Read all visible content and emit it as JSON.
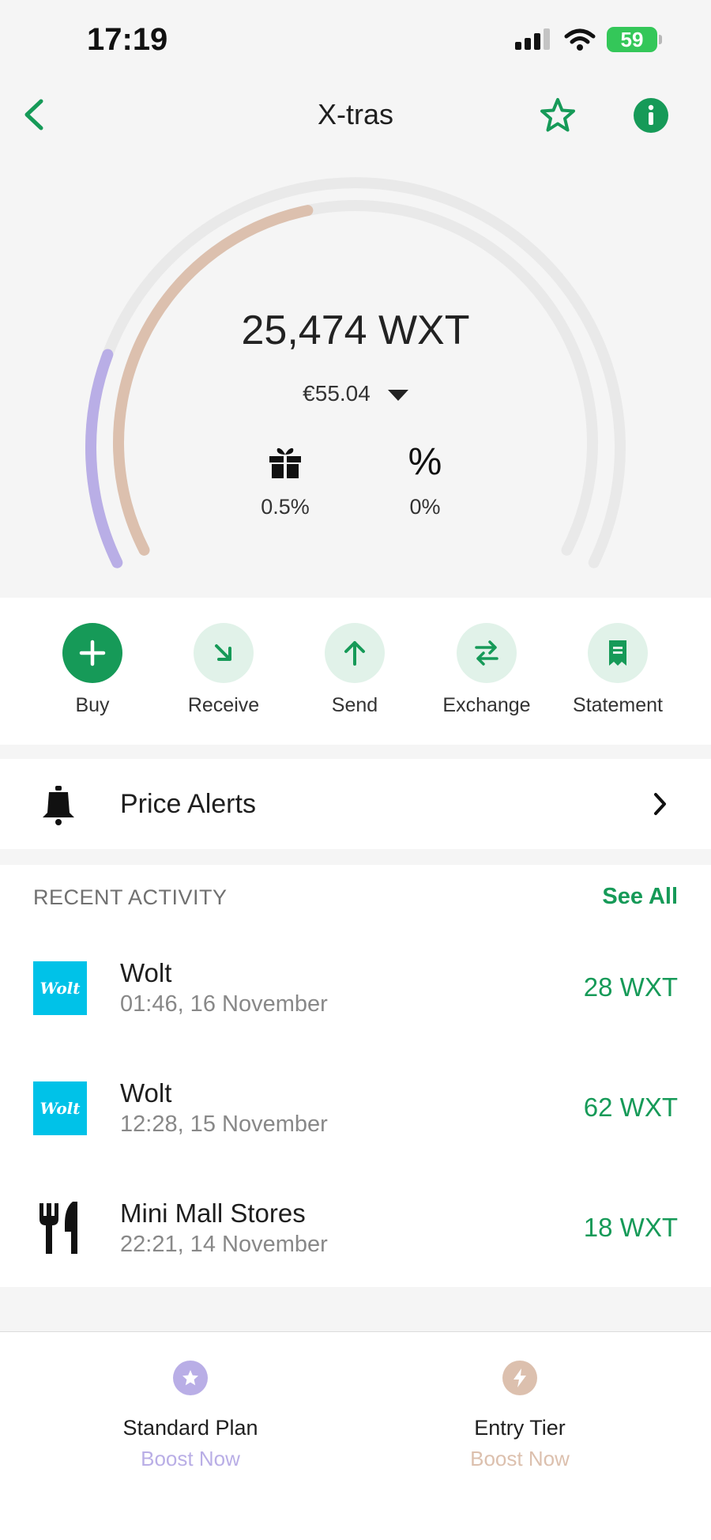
{
  "status_bar": {
    "time": "17:19",
    "battery": "59"
  },
  "nav": {
    "title": "X-tras"
  },
  "balance": {
    "amount": "25,474 WXT",
    "fiat": "€55.04",
    "reward_rate": "0.5%",
    "interest_rate": "0%"
  },
  "gauge": {
    "outer_progress": 0.2,
    "inner_progress": 0.45,
    "outer_color": "#b9aee6",
    "inner_color": "#dcc0ae",
    "track_color": "#e9e9e9"
  },
  "actions": [
    {
      "label": "Buy",
      "icon": "plus-icon"
    },
    {
      "label": "Receive",
      "icon": "arrow-down-right-icon"
    },
    {
      "label": "Send",
      "icon": "arrow-up-icon"
    },
    {
      "label": "Exchange",
      "icon": "exchange-icon"
    },
    {
      "label": "Statement",
      "icon": "receipt-icon"
    }
  ],
  "price_alerts": {
    "label": "Price Alerts",
    "icon": "bell-icon"
  },
  "recent_activity": {
    "header": "RECENT ACTIVITY",
    "see_all": "See All",
    "items": [
      {
        "logo": "Wolt",
        "name": "Wolt",
        "time": "01:46, 16 November",
        "amount": "28 WXT"
      },
      {
        "logo": "Wolt",
        "name": "Wolt",
        "time": "12:28, 15 November",
        "amount": "62 WXT"
      },
      {
        "logo": "fork-knife-icon",
        "name": "Mini Mall Stores",
        "time": "22:21, 14 November",
        "amount": "18 WXT"
      }
    ]
  },
  "plans": [
    {
      "title": "Standard Plan",
      "cta": "Boost Now",
      "color": "#b9aee6",
      "icon": "star-icon"
    },
    {
      "title": "Entry Tier",
      "cta": "Boost Now",
      "color": "#dcc0ae",
      "icon": "bolt-icon"
    }
  ],
  "colors": {
    "accent": "#169a58",
    "accent_light": "#e1f2e9"
  }
}
